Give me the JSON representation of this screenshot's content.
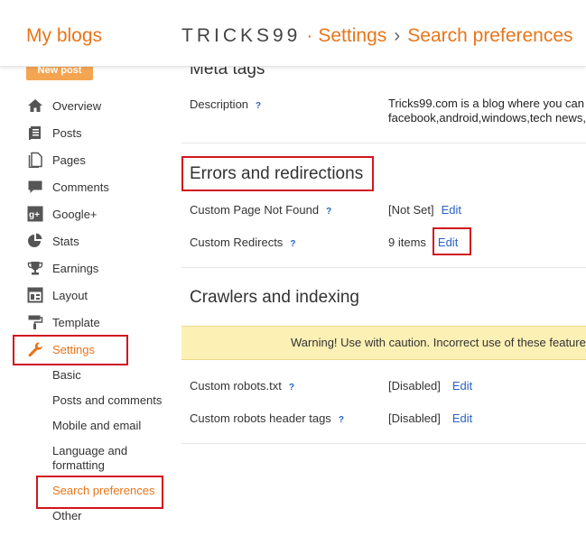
{
  "header": {
    "brand": "My blogs",
    "blog_name": "TRICKS99",
    "separator": "·",
    "section": "Settings",
    "arrow": "›",
    "page": "Search preferences"
  },
  "sidebar": {
    "new_post": "New post",
    "items": [
      {
        "label": "Overview",
        "icon": "home-icon"
      },
      {
        "label": "Posts",
        "icon": "posts-icon"
      },
      {
        "label": "Pages",
        "icon": "pages-icon"
      },
      {
        "label": "Comments",
        "icon": "comment-icon"
      },
      {
        "label": "Google+",
        "icon": "google-plus-icon"
      },
      {
        "label": "Stats",
        "icon": "pie-chart-icon"
      },
      {
        "label": "Earnings",
        "icon": "trophy-icon"
      },
      {
        "label": "Layout",
        "icon": "layout-icon"
      },
      {
        "label": "Template",
        "icon": "paint-roller-icon"
      },
      {
        "label": "Settings",
        "icon": "wrench-icon"
      }
    ],
    "sub_items": [
      "Basic",
      "Posts and comments",
      "Mobile and email",
      "Language and",
      "formatting",
      "Search preferences",
      "Other"
    ]
  },
  "content": {
    "meta_tags_title": "Meta tags",
    "description_label": "Description",
    "description_line1": "Tricks99.com is a blog where you can",
    "description_line2": "facebook,android,windows,tech news,",
    "errors_title": "Errors and redirections",
    "not_found_label": "Custom Page Not Found",
    "not_found_value": "[Not Set]",
    "redirects_label": "Custom Redirects",
    "redirects_value": "9 items",
    "crawlers_title": "Crawlers and indexing",
    "warning": "Warning! Use with caution. Incorrect use of these features",
    "robots_label": "Custom robots.txt",
    "robots_value": "[Disabled]",
    "robots_header_label": "Custom robots header tags",
    "robots_header_value": "[Disabled]",
    "edit": "Edit",
    "help": "?"
  },
  "colors": {
    "accent": "#e8751a",
    "link": "#2862c4",
    "highlight": "#d0161d",
    "warning_bg": "#fcf0b4"
  }
}
